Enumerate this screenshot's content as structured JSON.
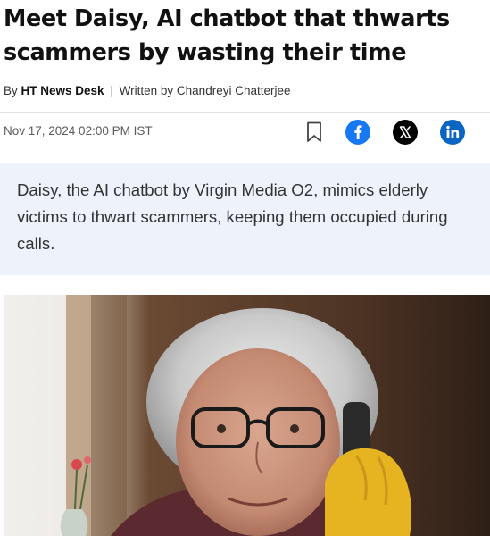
{
  "article": {
    "headline": "Meet Daisy, AI chatbot that thwarts scammers by wasting their time",
    "byline": {
      "by_prefix": "By",
      "desk": "HT News Desk",
      "separator": "|",
      "written_by_prefix": "Written by",
      "author": "Chandreyi Chatterjee"
    },
    "dateline": "Nov 17, 2024 02:00 PM IST",
    "summary": "Daisy, the AI chatbot by Virgin Media O2, mimics elderly victims to thwart scammers, keeping them occupied during calls."
  },
  "share": {
    "bookmark_icon": "bookmark-icon",
    "facebook_icon": "facebook-icon",
    "x_icon": "x-icon",
    "linkedin_icon": "linkedin-icon",
    "facebook_color": "#1877f2",
    "x_color": "#000000",
    "linkedin_color": "#0a66c2"
  },
  "hero_image": {
    "subject": "elderly woman with glasses on a phone wearing yellow gloves"
  }
}
